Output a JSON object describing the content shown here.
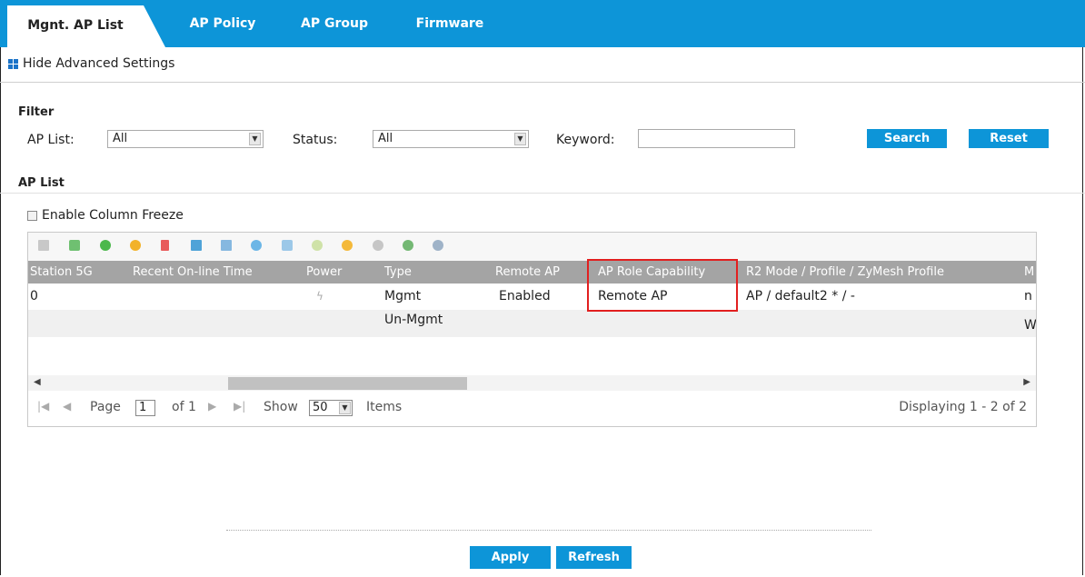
{
  "tabs": [
    {
      "label": "Mgnt. AP List",
      "active": true
    },
    {
      "label": "AP Policy",
      "active": false
    },
    {
      "label": "AP Group",
      "active": false
    },
    {
      "label": "Firmware",
      "active": false
    }
  ],
  "advanced_toggle": "Hide Advanced Settings",
  "filter": {
    "title": "Filter",
    "ap_list_label": "AP List:",
    "ap_list_value": "All",
    "status_label": "Status:",
    "status_value": "All",
    "keyword_label": "Keyword:",
    "keyword_value": "",
    "search_button": "Search",
    "reset_button": "Reset"
  },
  "ap_list": {
    "title": "AP List",
    "freeze_label": "Enable Column Freeze",
    "columns": [
      "Station 5G",
      "Recent On-line Time",
      "Power",
      "Type",
      "Remote AP",
      "AP Role Capability",
      "R2 Mode / Profile / ZyMesh Profile",
      "M"
    ],
    "rows": [
      {
        "station5g": "0",
        "recent": "",
        "power_icon": "power-plug-icon",
        "type": "Mgmt",
        "remote_ap": "Enabled",
        "role": "Remote AP",
        "r2": "AP / default2 * / -",
        "m": "n"
      },
      {
        "station5g": "",
        "recent": "",
        "power_icon": "",
        "type": "Un-Mgmt",
        "remote_ap": "",
        "role": "",
        "r2": "",
        "m": "W"
      }
    ],
    "pager": {
      "page_label": "Page",
      "page_value": "1",
      "of_label": "of 1",
      "show_label": "Show",
      "show_value": "50",
      "items_label": "Items",
      "display_text": "Displaying 1 - 2 of 2"
    }
  },
  "toolbar_icons": [
    "edit-icon",
    "add-user-icon",
    "add-icon",
    "power-icon",
    "delete-icon",
    "monitor-icon",
    "window-icon",
    "antenna-icon",
    "lock-icon",
    "settings-icon",
    "warning-icon",
    "search-icon",
    "check-icon",
    "refresh-icon"
  ],
  "apply_button": "Apply",
  "refresh_button": "Refresh",
  "colors": {
    "accent": "#0d95d8",
    "header": "#a4a4a4",
    "highlight": "#e21f1f"
  }
}
